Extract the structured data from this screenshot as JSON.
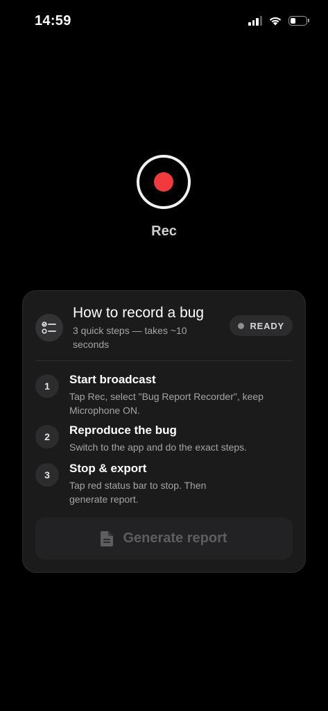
{
  "status_bar": {
    "time": "14:59",
    "battery_level": 0.35
  },
  "recorder": {
    "label": "Rec",
    "accent_color": "#f03a3e"
  },
  "card": {
    "title": "How to record a bug",
    "subtitle": "3 quick steps — takes ~10 seconds",
    "status_badge": "READY",
    "icon": "checklist-icon",
    "steps": [
      {
        "number": "1",
        "title": "Start broadcast",
        "description": "Tap Rec, select \"Bug Report Recorder\", keep Microphone ON."
      },
      {
        "number": "2",
        "title": "Reproduce the bug",
        "description": "Switch to the app and do the exact steps."
      },
      {
        "number": "3",
        "title": "Stop & export",
        "description": "Tap red status bar to stop. Then generate report."
      }
    ],
    "generate_button": {
      "label": "Generate report",
      "icon": "document-icon",
      "enabled": false
    }
  }
}
